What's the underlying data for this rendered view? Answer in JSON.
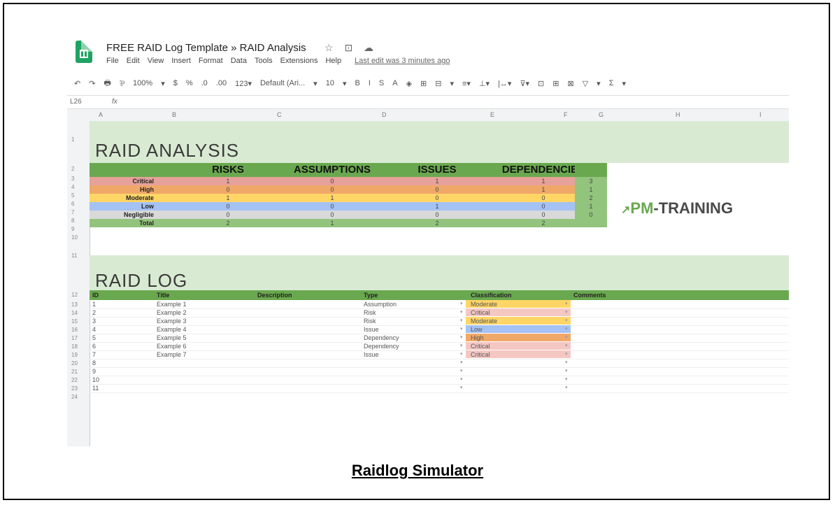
{
  "window": {
    "title": "FREE RAID Log Template » RAID Analysis",
    "title_icons": "☆ ⊡ ☁",
    "menu": [
      "File",
      "Edit",
      "View",
      "Insert",
      "Format",
      "Data",
      "Tools",
      "Extensions",
      "Help"
    ],
    "last_edit": "Last edit was 3 minutes ago"
  },
  "toolbar": {
    "items": [
      "↶",
      "↷",
      "🖶",
      "⅌",
      "100%",
      "▾",
      "$",
      "%",
      ".0",
      ".00",
      "123▾",
      "Default (Ari...",
      "▾",
      "10",
      "▾",
      "B",
      "I",
      "S",
      "A",
      "◈",
      "⊞",
      "⊟",
      "▾",
      "≡▾",
      "⊥▾",
      "|↔▾",
      "⊽▾",
      "⊡",
      "⊞",
      "⊠",
      "▽",
      "▾",
      "Σ",
      "▾"
    ]
  },
  "formula_bar": {
    "cell_ref": "L26",
    "fx": "fx"
  },
  "columns": [
    "A",
    "B",
    "C",
    "D",
    "E",
    "F",
    "G",
    "H",
    "I"
  ],
  "summary": {
    "heading": "RAID ANALYSIS",
    "headers": [
      "RISKS",
      "ASSUMPTIONS",
      "ISSUES",
      "DEPENDENCIES"
    ],
    "rows": [
      {
        "label": "Critical",
        "values": [
          "1",
          "0",
          "1",
          "1"
        ],
        "total": "3",
        "color": "#e6a19b"
      },
      {
        "label": "High",
        "values": [
          "0",
          "0",
          "0",
          "1"
        ],
        "total": "1",
        "color": "#f0a869"
      },
      {
        "label": "Moderate",
        "values": [
          "1",
          "1",
          "0",
          "0"
        ],
        "total": "2",
        "color": "#ffd666"
      },
      {
        "label": "Low",
        "values": [
          "0",
          "0",
          "1",
          "0"
        ],
        "total": "1",
        "color": "#a4c2f4"
      },
      {
        "label": "Negligible",
        "values": [
          "0",
          "0",
          "0",
          "0"
        ],
        "total": "0",
        "color": "#d9d9d9"
      },
      {
        "label": "Total",
        "values": [
          "2",
          "1",
          "2",
          "2"
        ],
        "total": "",
        "color": "#93c47d"
      }
    ]
  },
  "logo": {
    "mark": "↗",
    "pm": "PM",
    "rest": "-TRAINING"
  },
  "log": {
    "heading": "RAID LOG",
    "headers": [
      "ID",
      "Title",
      "Description",
      "Type",
      "Classification",
      "Comments"
    ],
    "rows": [
      {
        "id": "1",
        "title": "Example 1",
        "type": "Assumption",
        "class": "Moderate",
        "color": "#ffd666"
      },
      {
        "id": "2",
        "title": "Example 2",
        "type": "Risk",
        "class": "Critical",
        "color": "#f4c7c3"
      },
      {
        "id": "3",
        "title": "Example 3",
        "type": "Risk",
        "class": "Moderate",
        "color": "#ffd666"
      },
      {
        "id": "4",
        "title": "Example 4",
        "type": "Issue",
        "class": "Low",
        "color": "#a4c2f4"
      },
      {
        "id": "5",
        "title": "Example 5",
        "type": "Dependency",
        "class": "High",
        "color": "#f0a869"
      },
      {
        "id": "6",
        "title": "Example 6",
        "type": "Dependency",
        "class": "Critical",
        "color": "#f4c7c3"
      },
      {
        "id": "7",
        "title": "Example 7",
        "type": "Issue",
        "class": "Critical",
        "color": "#f4c7c3"
      },
      {
        "id": "8",
        "title": "",
        "type": "",
        "class": "",
        "color": ""
      },
      {
        "id": "9",
        "title": "",
        "type": "",
        "class": "",
        "color": ""
      },
      {
        "id": "10",
        "title": "",
        "type": "",
        "class": "",
        "color": ""
      },
      {
        "id": "11",
        "title": "",
        "type": "",
        "class": "",
        "color": ""
      }
    ]
  },
  "row_numbers": [
    "1",
    "2",
    "3",
    "4",
    "5",
    "6",
    "7",
    "8",
    "9",
    "10",
    "11",
    "12",
    "13",
    "14",
    "15",
    "16",
    "17",
    "18",
    "19",
    "20",
    "21",
    "22",
    "23",
    "24"
  ],
  "caption": "Raidlog Simulator"
}
